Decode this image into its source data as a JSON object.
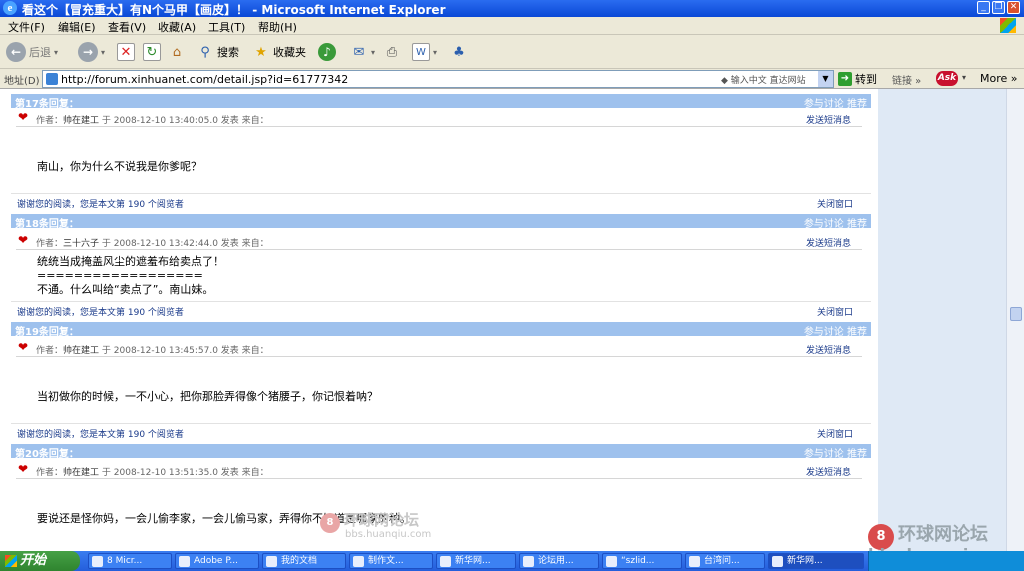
{
  "window": {
    "title": "看这个【冒充重大】有N个马甲【画皮】！ - Microsoft Internet Explorer"
  },
  "menu": [
    "文件(F)",
    "编辑(E)",
    "查看(V)",
    "收藏(A)",
    "工具(T)",
    "帮助(H)"
  ],
  "toolbar": {
    "back": "后退",
    "search": "搜索",
    "favorites": "收藏夹"
  },
  "address": {
    "label": "地址(D)",
    "url": "http://forum.xinhuanet.com/detail.jsp?id=61777342",
    "hint": "◆ 输入中文 直达网站",
    "go": "转到",
    "links": "链接",
    "ask": "Ask",
    "more": "More"
  },
  "posts": [
    {
      "number": "第17条回复：",
      "actions": "参与讨论 推荐",
      "meta_prefix": "作者：",
      "author": "帅在建工",
      "meta_suffix": "于 2008-12-10 13:40:05.0 发表   来自：",
      "send_message": "发送短消息",
      "body": "南山，你为什么不说我是你爹呢？",
      "footer": "谢谢您的阅读，您是本文第 190 个阅览者",
      "close": "关闭窗口"
    },
    {
      "number": "第18条回复：",
      "actions": "参与讨论 推荐",
      "meta_prefix": "作者：",
      "author": "三十六子",
      "meta_suffix": "于 2008-12-10 13:42:44.0 发表   来自：",
      "send_message": "发送短消息",
      "body": "统统当成掩盖风尘的遮羞布给卖点了！\n==================\n不通。什么叫给“卖点了”。南山妹。",
      "footer": "谢谢您的阅读，您是本文第 190 个阅览者",
      "close": "关闭窗口"
    },
    {
      "number": "第19条回复：",
      "actions": "参与讨论 推荐",
      "meta_prefix": "作者：",
      "author": "帅在建工",
      "meta_suffix": "于 2008-12-10 13:45:57.0 发表   来自：",
      "send_message": "发送短消息",
      "body": "当初做你的时候，一不小心，把你那脸弄得像个猪腰子，你记恨着呐？",
      "footer": "谢谢您的阅读，您是本文第 190 个阅览者",
      "close": "关闭窗口"
    },
    {
      "number": "第20条回复：",
      "actions": "参与讨论 推荐",
      "meta_prefix": "作者：",
      "author": "帅在建工",
      "meta_suffix": "于 2008-12-10 13:51:35.0 发表   来自：",
      "send_message": "发送短消息",
      "body": "要说还是怪你妈，一会儿偷李家，一会儿偷马家，弄得你不知道是哪家的种。"
    }
  ],
  "watermark": {
    "site_cn": "环球网论坛",
    "site_url": "bbs.huanqiu.com",
    "logo_char": "8"
  },
  "taskbar": {
    "start": "开始",
    "tasks": [
      "8 Micr...",
      "Adobe P...",
      "我的文档",
      "制作文...",
      "新华网...",
      "论坛用...",
      "“szlid...",
      "台湾问...",
      "新华网..."
    ]
  }
}
